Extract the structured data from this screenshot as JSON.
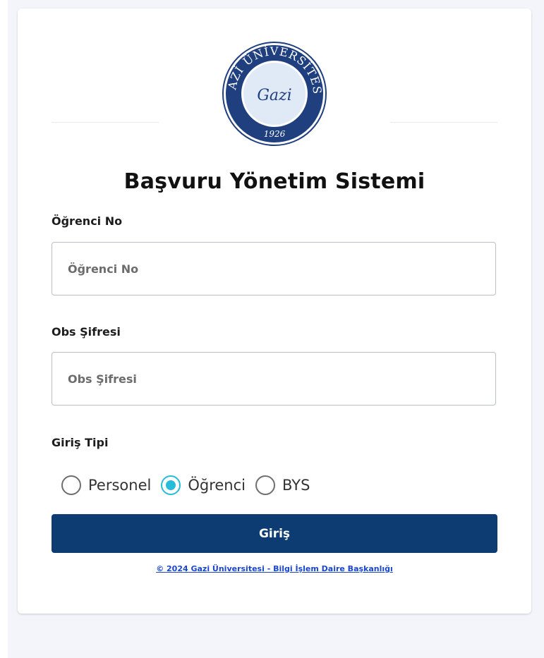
{
  "logo": {
    "ring_text": "GAZİ ÜNİVERSİTESİ",
    "signature": "Gazi",
    "year": "1926"
  },
  "title": "Başvuru Yönetim Sistemi",
  "student_no": {
    "label": "Öğrenci No",
    "placeholder": "Öğrenci No"
  },
  "password": {
    "label": "Obs Şifresi",
    "placeholder": "Obs Şifresi"
  },
  "login_type": {
    "label": "Giriş Tipi",
    "options": [
      {
        "label": "Personel",
        "checked": false
      },
      {
        "label": "Öğrenci",
        "checked": true
      },
      {
        "label": "BYS",
        "checked": false
      }
    ]
  },
  "submit_label": "Giriş",
  "footer": "© 2024 Gazi Üniversitesi - Bilgi İşlem Daire Başkanlığı",
  "colors": {
    "primary": "#0d3c72",
    "radio_accent": "#27bcd8",
    "link": "#1a46c7",
    "logo_navy": "#1f3f7f",
    "logo_inner": "#dfeaf6"
  }
}
